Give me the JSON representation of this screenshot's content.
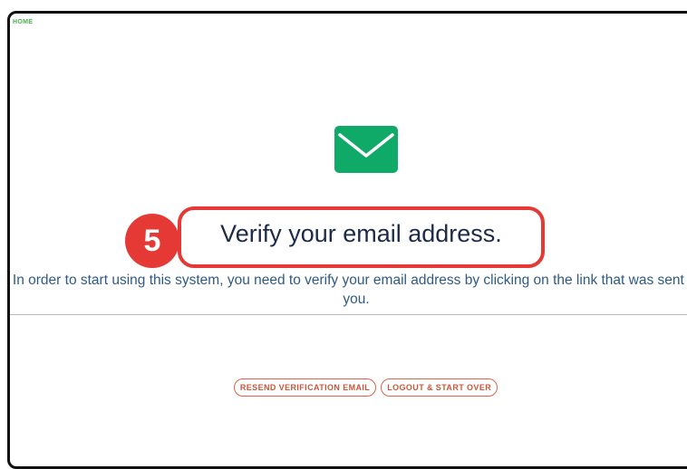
{
  "nav": {
    "home_label": "HOME"
  },
  "icons": {
    "mail": "envelope-icon"
  },
  "annotation": {
    "step_number": "5"
  },
  "page": {
    "title": "Verify your email address.",
    "instructions": "In order to start using this system, you need to verify your email address by clicking on the link that was sent to you."
  },
  "actions": {
    "resend_label": "RESEND VERIFICATION EMAIL",
    "logout_label": "LOGOUT & START OVER"
  },
  "colors": {
    "accent_green": "#0fa968",
    "annotation_red": "#e53935",
    "button_orange": "#c8563b",
    "text_blue": "#2f5a83"
  }
}
